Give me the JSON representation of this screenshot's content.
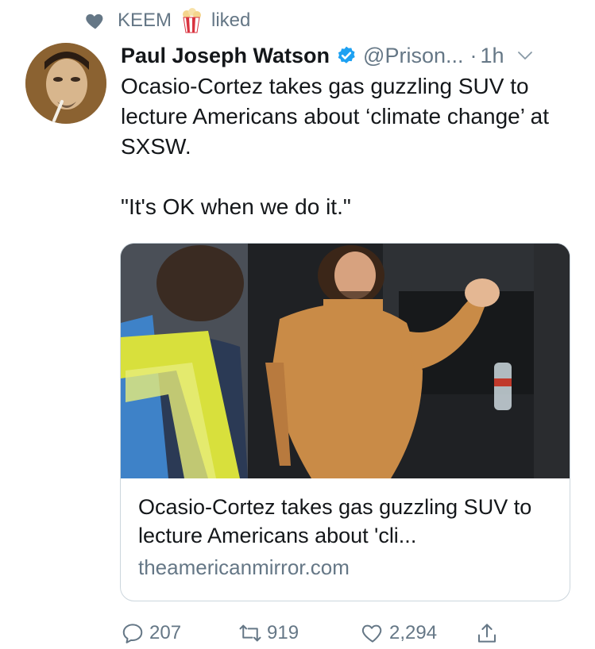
{
  "social_context": {
    "user": "KEEM",
    "action": "liked",
    "icon": "heart-icon",
    "emoji": "popcorn-icon"
  },
  "tweet": {
    "author_name": "Paul Joseph Watson",
    "author_handle": "@Prison...",
    "separator": "·",
    "time": "1h",
    "text": "Ocasio-Cortez takes gas guzzling SUV to lecture Americans about ‘climate change’ at SXSW.\n\n\"It's OK when we do it.\""
  },
  "card": {
    "title": "Ocasio-Cortez takes gas guzzling SUV to lecture Americans about 'cli...",
    "domain": "theamericanmirror.com"
  },
  "actions": {
    "replies": "207",
    "retweets": "919",
    "likes": "2,294"
  },
  "colors": {
    "text": "#14171a",
    "muted": "#657786",
    "verified": "#1da1f2",
    "border": "#ccd6dd"
  }
}
